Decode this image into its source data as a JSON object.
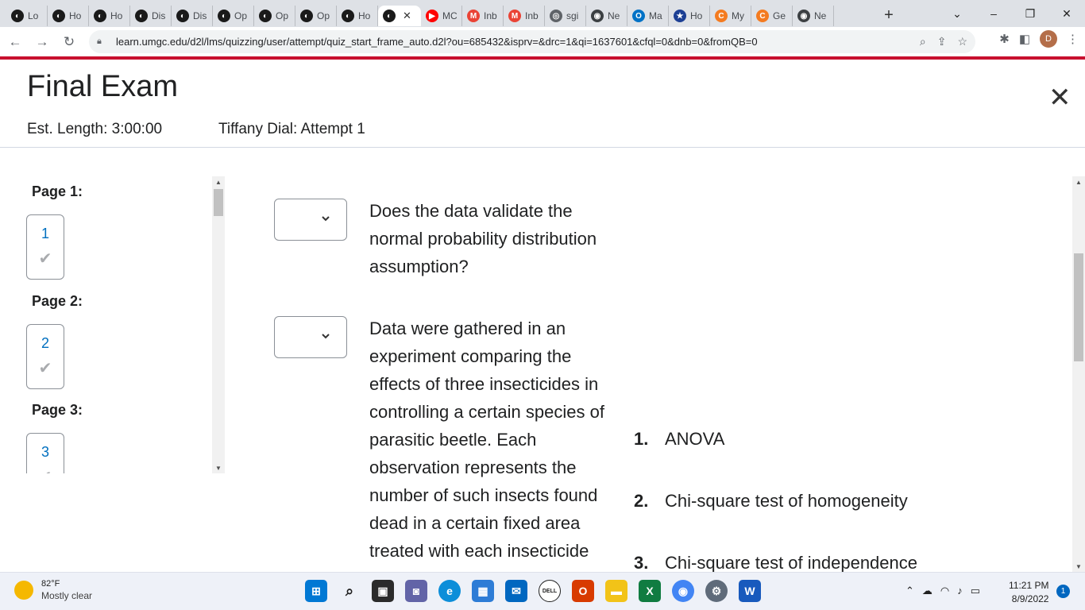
{
  "browser": {
    "tabs": [
      {
        "label": "Lo",
        "color": "#1a1a1a",
        "glyph": "◐"
      },
      {
        "label": "Ho",
        "color": "#1a1a1a",
        "glyph": "◐"
      },
      {
        "label": "Ho",
        "color": "#1a1a1a",
        "glyph": "◐"
      },
      {
        "label": "Dis",
        "color": "#1a1a1a",
        "glyph": "◐"
      },
      {
        "label": "Dis",
        "color": "#1a1a1a",
        "glyph": "◐"
      },
      {
        "label": "Op",
        "color": "#1a1a1a",
        "glyph": "◐"
      },
      {
        "label": "Op",
        "color": "#1a1a1a",
        "glyph": "◐"
      },
      {
        "label": "Op",
        "color": "#1a1a1a",
        "glyph": "◐"
      },
      {
        "label": "Ho",
        "color": "#1a1a1a",
        "glyph": "◐"
      },
      {
        "label": "",
        "color": "#1a1a1a",
        "glyph": "◐",
        "active": true
      },
      {
        "label": "MC",
        "color": "#ff0000",
        "glyph": "▶"
      },
      {
        "label": "Inb",
        "color": "#ea4335",
        "glyph": "M"
      },
      {
        "label": "Inb",
        "color": "#ea4335",
        "glyph": "M"
      },
      {
        "label": "sgi",
        "color": "#5f6368",
        "glyph": "◎"
      },
      {
        "label": "Ne",
        "color": "#3c4043",
        "glyph": "◉"
      },
      {
        "label": "Ma",
        "color": "#0072c6",
        "glyph": "O"
      },
      {
        "label": "Ho",
        "color": "#1c3f94",
        "glyph": "★"
      },
      {
        "label": "My",
        "color": "#f47b20",
        "glyph": "C"
      },
      {
        "label": "Ge",
        "color": "#f47b20",
        "glyph": "C"
      },
      {
        "label": "Ne",
        "color": "#3c4043",
        "glyph": "◉"
      }
    ],
    "url": "learn.umgc.edu/d2l/lms/quizzing/user/attempt/quiz_start_frame_auto.d2l?ou=685432&isprv=&drc=1&qi=1637601&cfql=0&dnb=0&fromQB=0",
    "profile_initial": "D"
  },
  "quiz": {
    "title": "Final Exam",
    "est_length": "Est. Length: 3:00:00",
    "attempt": "Tiffany Dial: Attempt 1"
  },
  "pages": [
    {
      "label": "Page 1:",
      "question": "1",
      "answered": true
    },
    {
      "label": "Page 2:",
      "question": "2",
      "answered": true
    },
    {
      "label": "Page 3:",
      "question": "3",
      "answered": true
    }
  ],
  "questions": [
    {
      "text": "Does the data validate the normal probability distribution assumption?"
    },
    {
      "text": "Data were gathered in an experiment comparing the effects of three insecticides in controlling a certain species of parasitic beetle. Each observation represents the number of such insects found dead in a certain fixed area treated with each insecticide"
    }
  ],
  "answers": [
    {
      "num": "1.",
      "label": "ANOVA"
    },
    {
      "num": "2.",
      "label": "Chi-square test of homogeneity"
    },
    {
      "num": "3.",
      "label": "Chi-square test of independence"
    }
  ],
  "taskbar": {
    "temp": "82°F",
    "condition": "Mostly clear",
    "time": "11:21 PM",
    "date": "8/9/2022",
    "notifications": "1"
  },
  "colors": {
    "accent_red": "#c8102e",
    "link_blue": "#006fbf"
  }
}
